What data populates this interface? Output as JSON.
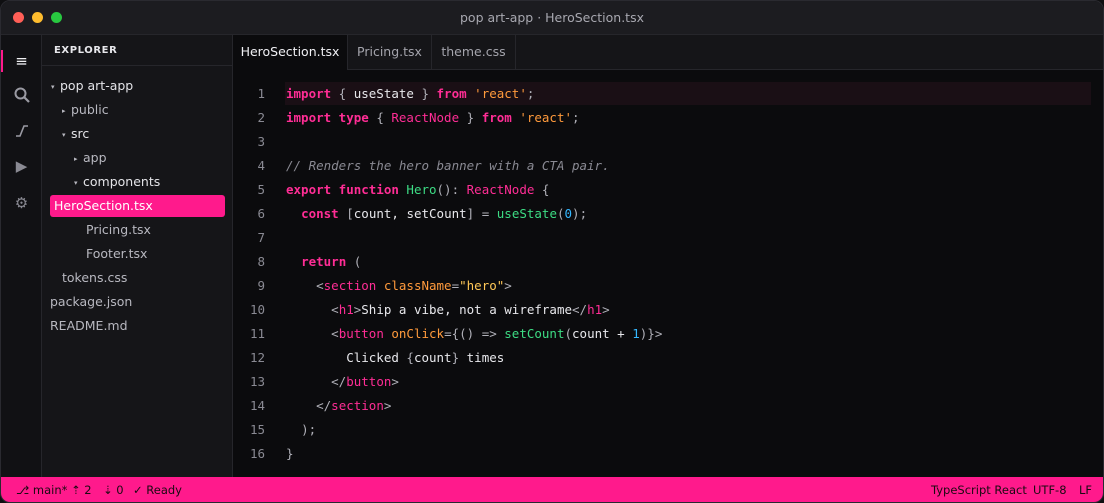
{
  "window": {
    "title": "pop art-app · HeroSection.tsx"
  },
  "activity": {
    "items": [
      {
        "icon": "menu-icon",
        "glyph": "≡"
      },
      {
        "icon": "search-icon",
        "glyph": "🔍"
      },
      {
        "icon": "source-control-icon",
        "glyph": "⎎"
      },
      {
        "icon": "run-icon",
        "glyph": "▶"
      },
      {
        "icon": "gear-icon",
        "glyph": "⚙"
      }
    ]
  },
  "explorer": {
    "header": "EXPLORER",
    "tree": [
      {
        "label": "pop art-app",
        "caret": "▾"
      },
      {
        "label": "public",
        "caret": "▸"
      },
      {
        "label": "src",
        "caret": "▾"
      },
      {
        "label": "app",
        "caret": "▸"
      },
      {
        "label": "components",
        "caret": "▾"
      },
      {
        "label": "HeroSection.tsx",
        "caret": ""
      },
      {
        "label": "Pricing.tsx",
        "caret": ""
      },
      {
        "label": "Footer.tsx",
        "caret": ""
      },
      {
        "label": "tokens.css",
        "caret": ""
      },
      {
        "label": "package.json",
        "caret": ""
      },
      {
        "label": "README.md",
        "caret": ""
      }
    ]
  },
  "tabs": [
    {
      "label": "HeroSection.tsx",
      "active": true
    },
    {
      "label": "Pricing.tsx",
      "active": false
    },
    {
      "label": "theme.css",
      "active": false
    }
  ],
  "editor": {
    "lines": [
      {
        "num": "1",
        "tokens": [
          [
            "k",
            "import"
          ],
          [
            "p",
            " { "
          ],
          [
            "",
            "useState"
          ],
          [
            "p",
            " } "
          ],
          [
            "k",
            "from"
          ],
          [
            "s",
            " 'react'"
          ],
          [
            "p",
            ";"
          ]
        ]
      },
      {
        "num": "2",
        "tokens": [
          [
            "k",
            "import"
          ],
          [
            "k",
            " type"
          ],
          [
            "p",
            " { "
          ],
          [
            "t",
            "ReactNode"
          ],
          [
            "p",
            " } "
          ],
          [
            "k",
            "from"
          ],
          [
            "s",
            " 'react'"
          ],
          [
            "p",
            ";"
          ]
        ]
      },
      {
        "num": "3",
        "tokens": []
      },
      {
        "num": "4",
        "tokens": [
          [
            "c",
            "// Renders the hero banner with a CTA pair."
          ]
        ]
      },
      {
        "num": "5",
        "tokens": [
          [
            "k",
            "export"
          ],
          [
            "k",
            " function"
          ],
          [
            "f",
            " Hero"
          ],
          [
            "p",
            "(): "
          ],
          [
            "t",
            "ReactNode"
          ],
          [
            "p",
            " {"
          ]
        ]
      },
      {
        "num": "6",
        "tokens": [
          [
            "",
            "  "
          ],
          [
            "k",
            "const"
          ],
          [
            "p",
            " ["
          ],
          [
            "",
            "count, setCount"
          ],
          [
            "p",
            "] = "
          ],
          [
            "f",
            "useState"
          ],
          [
            "p",
            "("
          ],
          [
            "n",
            "0"
          ],
          [
            "p",
            ");"
          ]
        ]
      },
      {
        "num": "7",
        "tokens": []
      },
      {
        "num": "8",
        "tokens": [
          [
            "",
            "  "
          ],
          [
            "k",
            "return"
          ],
          [
            "p",
            " ("
          ]
        ]
      },
      {
        "num": "9",
        "tokens": [
          [
            "",
            "    "
          ],
          [
            "p",
            "<"
          ],
          [
            "tag",
            "section"
          ],
          [
            "attr",
            " className"
          ],
          [
            "p",
            "="
          ],
          [
            "str",
            "\"hero\""
          ],
          [
            "p",
            ">"
          ]
        ]
      },
      {
        "num": "10",
        "tokens": [
          [
            "",
            "      "
          ],
          [
            "p",
            "<"
          ],
          [
            "tag",
            "h1"
          ],
          [
            "p",
            ">"
          ],
          [
            "",
            "Ship a vibe, not a wireframe"
          ],
          [
            "p",
            "</"
          ],
          [
            "tag",
            "h1"
          ],
          [
            "p",
            ">"
          ]
        ]
      },
      {
        "num": "11",
        "tokens": [
          [
            "",
            "      "
          ],
          [
            "p",
            "<"
          ],
          [
            "tag",
            "button"
          ],
          [
            "attr",
            " onClick"
          ],
          [
            "p",
            "={() => "
          ],
          [
            "f",
            "setCount"
          ],
          [
            "p",
            "("
          ],
          [
            "",
            "count + "
          ],
          [
            "n",
            "1"
          ],
          [
            "p",
            ")}>"
          ]
        ]
      },
      {
        "num": "12",
        "tokens": [
          [
            "",
            "        Clicked "
          ],
          [
            "p",
            "{"
          ],
          [
            "",
            "count"
          ],
          [
            "p",
            "}"
          ],
          [
            "",
            " times"
          ]
        ]
      },
      {
        "num": "13",
        "tokens": [
          [
            "",
            "      "
          ],
          [
            "p",
            "</"
          ],
          [
            "tag",
            "button"
          ],
          [
            "p",
            ">"
          ]
        ]
      },
      {
        "num": "14",
        "tokens": [
          [
            "",
            "    "
          ],
          [
            "p",
            "</"
          ],
          [
            "tag",
            "section"
          ],
          [
            "p",
            ">"
          ]
        ]
      },
      {
        "num": "15",
        "tokens": [
          [
            "",
            "  "
          ],
          [
            "p",
            ");"
          ]
        ]
      },
      {
        "num": "16",
        "tokens": [
          [
            "p",
            "}"
          ]
        ]
      }
    ]
  },
  "status": {
    "branch": "⎇ main*",
    "ahead": "⇡ 2",
    "behind": "⇣ 0",
    "ready": "✓ Ready",
    "language": "TypeScript React",
    "encoding": "UTF-8",
    "eol": "LF"
  },
  "colors": {
    "accent": "#ff1a8c"
  }
}
